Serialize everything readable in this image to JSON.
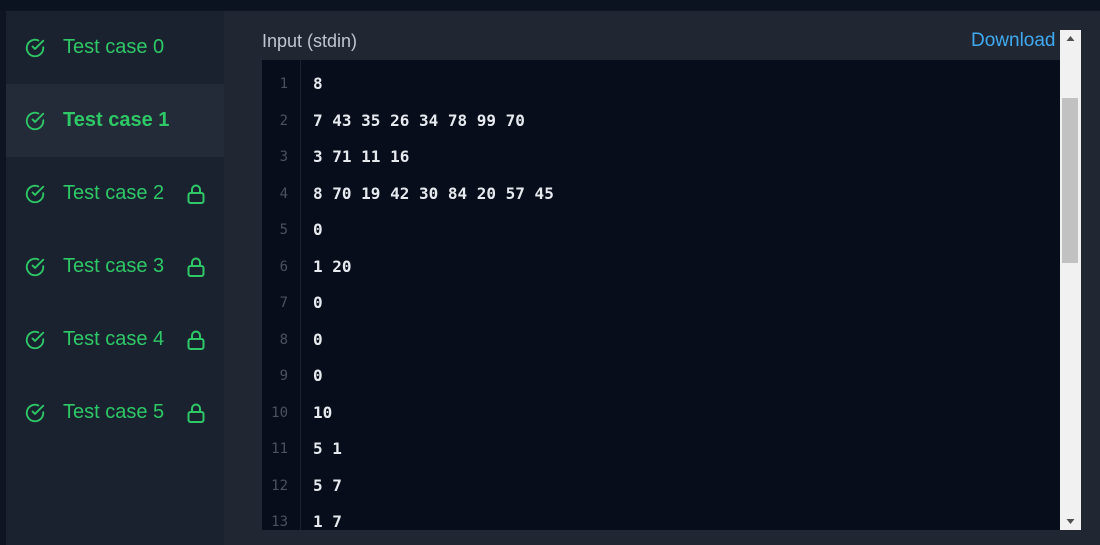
{
  "sidebar": {
    "items": [
      {
        "label": "Test case 0",
        "locked": false,
        "active": false
      },
      {
        "label": "Test case 1",
        "locked": false,
        "active": true
      },
      {
        "label": "Test case 2",
        "locked": true,
        "active": false
      },
      {
        "label": "Test case 3",
        "locked": true,
        "active": false
      },
      {
        "label": "Test case 4",
        "locked": true,
        "active": false
      },
      {
        "label": "Test case 5",
        "locked": true,
        "active": false
      }
    ]
  },
  "panel": {
    "title": "Input (stdin)",
    "download_label": "Download"
  },
  "editor": {
    "lines": [
      {
        "num": "1",
        "text": "8"
      },
      {
        "num": "2",
        "text": "7 43 35 26 34 78 99 70"
      },
      {
        "num": "3",
        "text": "3 71 11 16"
      },
      {
        "num": "4",
        "text": "8 70 19 42 30 84 20 57 45"
      },
      {
        "num": "5",
        "text": "0"
      },
      {
        "num": "6",
        "text": "1 20"
      },
      {
        "num": "7",
        "text": "0"
      },
      {
        "num": "8",
        "text": "0"
      },
      {
        "num": "9",
        "text": "0"
      },
      {
        "num": "10",
        "text": "10"
      },
      {
        "num": "11",
        "text": "5 1"
      },
      {
        "num": "12",
        "text": "5 7"
      },
      {
        "num": "13",
        "text": "1 7"
      }
    ]
  },
  "colors": {
    "accent_green": "#2ec866",
    "link_blue": "#40a9ef",
    "editor_bg": "#070d1a"
  },
  "icons": {
    "check": "check-circle-icon",
    "lock": "lock-icon"
  }
}
